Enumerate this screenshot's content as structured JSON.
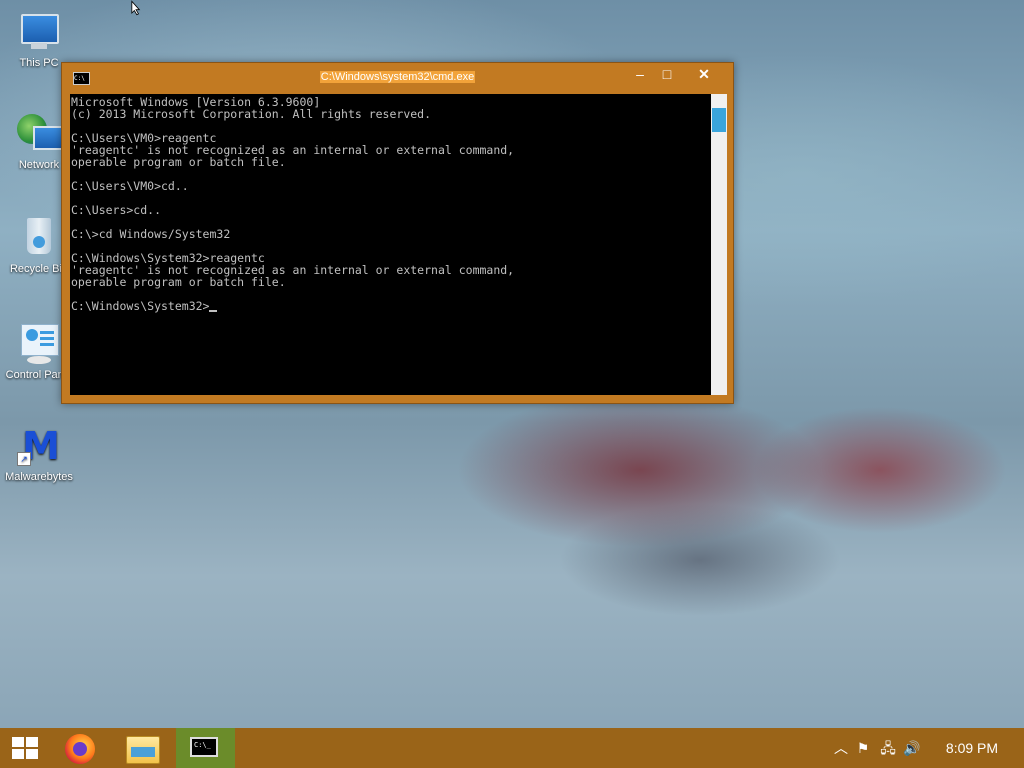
{
  "desktop": {
    "icons": [
      {
        "label": "This PC",
        "icon": "this-pc-icon"
      },
      {
        "label": "Network",
        "icon": "network-icon"
      },
      {
        "label": "Recycle Bin",
        "icon": "recycle-bin-icon"
      },
      {
        "label": "Control Panel",
        "icon": "control-panel-icon"
      },
      {
        "label": "Malwarebytes",
        "icon": "malwarebytes-icon"
      }
    ]
  },
  "cmd_window": {
    "title": "C:\\Windows\\system32\\cmd.exe",
    "icon_text": "C:\\",
    "minimize_glyph": "–",
    "maximize_glyph": "□",
    "close_glyph": "✕",
    "console_output": "Microsoft Windows [Version 6.3.9600]\n(c) 2013 Microsoft Corporation. All rights reserved.\n\nC:\\Users\\VM0>reagentc\n'reagentc' is not recognized as an internal or external command,\noperable program or batch file.\n\nC:\\Users\\VM0>cd..\n\nC:\\Users>cd..\n\nC:\\>cd Windows/System32\n\nC:\\Windows\\System32>reagentc\n'reagentc' is not recognized as an internal or external command,\noperable program or batch file.\n\nC:\\Windows\\System32>"
  },
  "taskbar": {
    "cmd_icon_text": "C:\\_",
    "tray": {
      "up_glyph": "︿",
      "flag_glyph": "⚑",
      "network_glyph": "🖧",
      "volume_glyph": "🔊"
    },
    "clock": "8:09 PM"
  },
  "colors": {
    "accent": "#c27a22",
    "taskbar": "#9a6418",
    "console_bg": "#000000",
    "console_fg": "#c0c0c0"
  }
}
